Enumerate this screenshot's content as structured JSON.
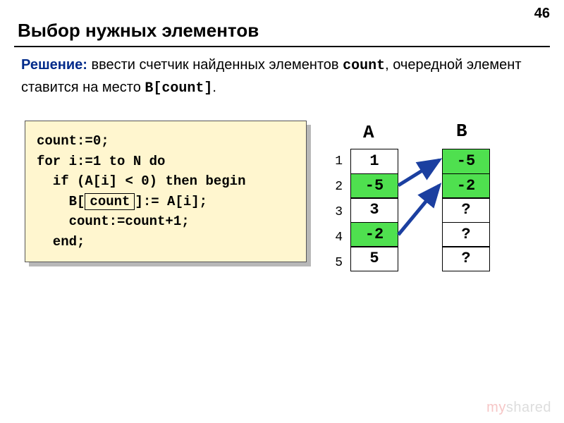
{
  "page_number": "46",
  "title": "Выбор нужных элементов",
  "solution": {
    "lead": "Решение:",
    "text1": " ввести счетчик найденных элементов ",
    "mono1": "count",
    "text2": ", очередной элемент ставится на место ",
    "mono2": "B[count]",
    "text3": "."
  },
  "code": {
    "l1": "count:=0;",
    "l2": "for i:=1 to N do",
    "l3a": "  if (A[i]",
    "l3b": "<",
    "l3c": "0) then begin",
    "l4a": "    B[",
    "l4_count": "count",
    "l4b": "]:= A[i];",
    "l5": "    count:=count+1;",
    "l6": "  end;"
  },
  "arrays": {
    "A_header": "A",
    "B_header": "B",
    "indices": [
      "1",
      "2",
      "3",
      "4",
      "5"
    ],
    "A": [
      {
        "v": "1",
        "hl": false
      },
      {
        "v": "-5",
        "hl": true
      },
      {
        "v": "3",
        "hl": false
      },
      {
        "v": "-2",
        "hl": true
      },
      {
        "v": "5",
        "hl": false
      }
    ],
    "B": [
      {
        "v": "-5",
        "hl": true
      },
      {
        "v": "-2",
        "hl": true
      },
      {
        "v": "?",
        "hl": false
      },
      {
        "v": "?",
        "hl": false
      },
      {
        "v": "?",
        "hl": false
      }
    ]
  },
  "watermark": {
    "t1": "my",
    "t2": "shared",
    ".ru": ""
  }
}
